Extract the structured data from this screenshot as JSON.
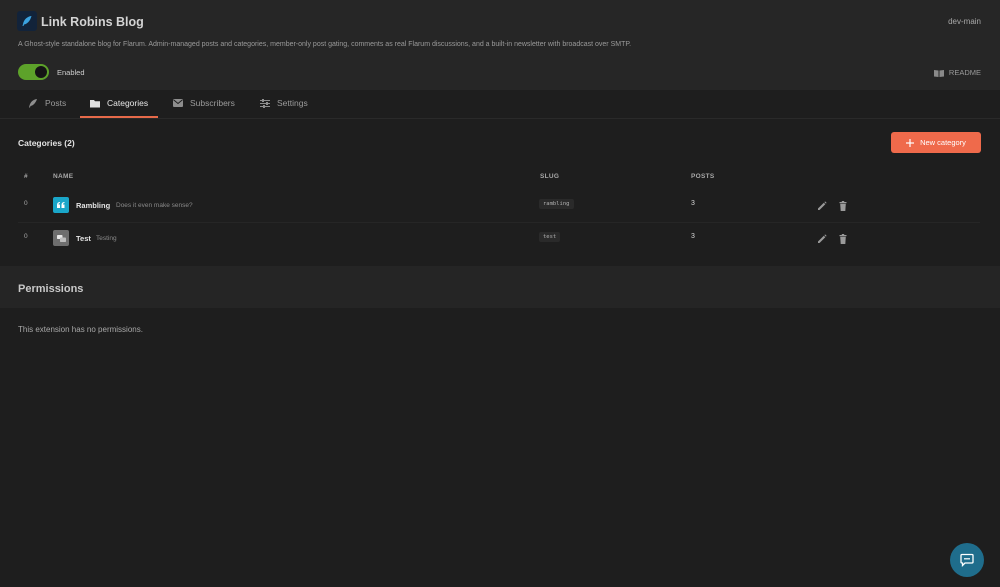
{
  "header": {
    "title": "Link Robins Blog",
    "version": "dev-main",
    "description": "A Ghost-style standalone blog for Flarum. Admin-managed posts and categories, member-only post gating, comments as real Flarum discussions, and a built-in newsletter with broadcast over SMTP.",
    "toggle_label": "Enabled",
    "toggle_on": true,
    "readme_label": "README",
    "logo_icon": "feather-icon"
  },
  "tabs": [
    {
      "label": "Posts",
      "icon": "feather-icon",
      "active": false
    },
    {
      "label": "Categories",
      "icon": "folder-icon",
      "active": true
    },
    {
      "label": "Subscribers",
      "icon": "envelope-icon",
      "active": false
    },
    {
      "label": "Settings",
      "icon": "sliders-icon",
      "active": false
    }
  ],
  "categories": {
    "title": "Categories (2)",
    "new_button": "New category",
    "columns": {
      "order": "#",
      "name": "NAME",
      "slug": "SLUG",
      "posts": "POSTS"
    },
    "rows": [
      {
        "order": "0",
        "icon": "quote-icon",
        "icon_color": "#1aa6c9",
        "name": "Rambling",
        "description": "Does it even make sense?",
        "slug": "rambling",
        "posts": "3"
      },
      {
        "order": "0",
        "icon": "comments-icon",
        "icon_color": "#6e6e6e",
        "name": "Test",
        "description": "Testing",
        "slug": "test",
        "posts": "3"
      }
    ]
  },
  "permissions": {
    "title": "Permissions",
    "text": "This extension has no permissions."
  },
  "colors": {
    "accent": "#ef6a4b",
    "toggle": "#5da22a",
    "chat": "#1f6d8c"
  }
}
